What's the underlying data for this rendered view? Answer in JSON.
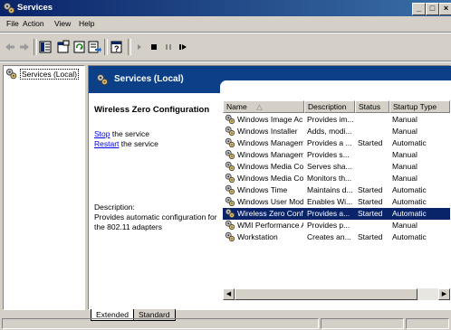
{
  "window": {
    "title": "Services"
  },
  "menu": [
    "File",
    "Action",
    "View",
    "Help"
  ],
  "toolbar": {
    "buttons": [
      "back-icon",
      "forward-icon",
      "show-hide-tree-icon",
      "properties-icon",
      "refresh-icon",
      "export-list-icon",
      "help-icon",
      "start-icon",
      "stop-icon",
      "pause-icon",
      "restart-icon"
    ]
  },
  "tree": {
    "root_label": "Services (Local)"
  },
  "header": {
    "title": "Services (Local)"
  },
  "detail": {
    "service_name": "Wireless Zero Configuration",
    "stop_link": "Stop",
    "stop_suffix": " the service",
    "restart_link": "Restart",
    "restart_suffix": " the service",
    "description_label": "Description:",
    "description_text": "Provides automatic configuration for the 802.11 adapters"
  },
  "columns": [
    "Name",
    "Description",
    "Status",
    "Startup Type"
  ],
  "rows": [
    {
      "name": "Windows Image Ac...",
      "description": "Provides im...",
      "status": "",
      "startup": "Manual"
    },
    {
      "name": "Windows Installer",
      "description": "Adds, modi...",
      "status": "",
      "startup": "Manual"
    },
    {
      "name": "Windows Managem...",
      "description": "Provides a ...",
      "status": "Started",
      "startup": "Automatic"
    },
    {
      "name": "Windows Managem...",
      "description": "Provides s...",
      "status": "",
      "startup": "Manual"
    },
    {
      "name": "Windows Media Con...",
      "description": "Serves sha...",
      "status": "",
      "startup": "Manual"
    },
    {
      "name": "Windows Media Con...",
      "description": "Monitors th...",
      "status": "",
      "startup": "Manual"
    },
    {
      "name": "Windows Time",
      "description": "Maintains d...",
      "status": "Started",
      "startup": "Automatic"
    },
    {
      "name": "Windows User Mod...",
      "description": "Enables Wi...",
      "status": "Started",
      "startup": "Automatic"
    },
    {
      "name": "Wireless Zero Confi...",
      "description": "Provides a...",
      "status": "Started",
      "startup": "Automatic",
      "selected": true
    },
    {
      "name": "WMI Performance A...",
      "description": "Provides p...",
      "status": "",
      "startup": "Manual"
    },
    {
      "name": "Workstation",
      "description": "Creates an...",
      "status": "Started",
      "startup": "Automatic"
    }
  ],
  "tabs": [
    "Extended",
    "Standard"
  ],
  "active_tab": "Extended",
  "colors": {
    "title_start": "#0a246a",
    "title_end": "#3a6ea5",
    "header_blue": "#0b3f88",
    "selection": "#0a246a",
    "link": "#0000ee"
  }
}
